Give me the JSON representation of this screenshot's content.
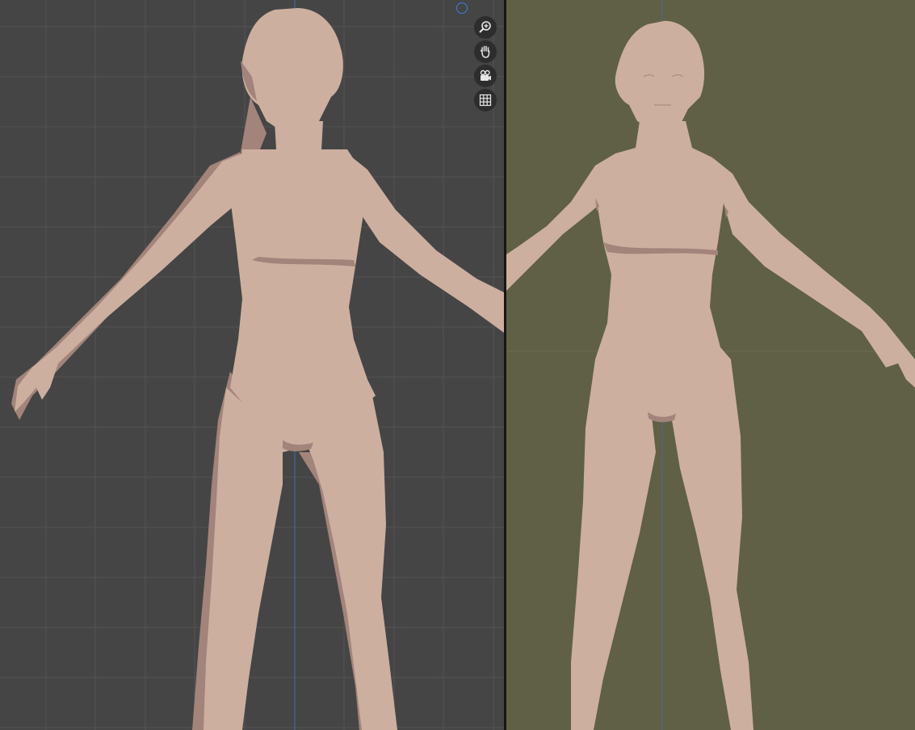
{
  "colors": {
    "left_bg": "#454545",
    "left_grid": "#525252",
    "right_bg": "#5f6045",
    "right_grid": "#6b6c52",
    "axis_line": "#3d6fb8",
    "skin": "#cdafa0",
    "skin_shadow": "#a3847a",
    "gizmo_bg": "#2d2d2d",
    "gizmo_icon": "#e6e6e6",
    "axis_gizmo": "#3d7edb"
  },
  "viewports": [
    {
      "name": "solid-shading-viewport",
      "background": "grid"
    },
    {
      "name": "material-preview-viewport",
      "background": "world-color"
    }
  ],
  "navigation_gizmo": {
    "buttons": [
      {
        "icon": "zoom-icon"
      },
      {
        "icon": "pan-hand-icon"
      },
      {
        "icon": "camera-view-icon"
      },
      {
        "icon": "orthographic-grid-icon"
      }
    ],
    "axis": "z-axis-gizmo"
  }
}
